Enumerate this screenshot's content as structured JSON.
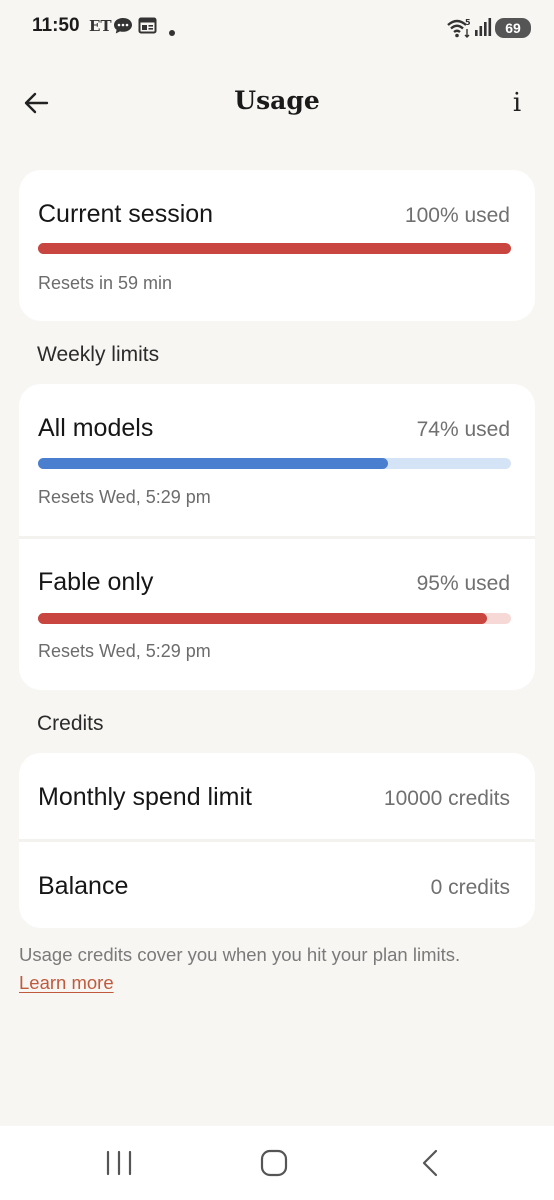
{
  "status_bar": {
    "time": "11:50",
    "carrier_label": "ET",
    "battery": "69",
    "icons": [
      "chat-bubble-icon",
      "calendar-icon",
      "dot-icon",
      "wifi-icon",
      "signal-icon"
    ]
  },
  "header": {
    "title": "Usage",
    "info_label": "i"
  },
  "current_session": {
    "title": "Current session",
    "used_label": "100% used",
    "used_fraction": 1.0,
    "reset_text": "Resets in 59 min"
  },
  "weekly": {
    "section_label": "Weekly limits",
    "items": [
      {
        "title": "All models",
        "used_label": "74% used",
        "used_fraction": 0.74,
        "reset_text": "Resets Wed, 5:29 pm",
        "fill_color": "#4a7fd0",
        "track_color": "#d5e3f7"
      },
      {
        "title": "Fable only",
        "used_label": "95% used",
        "used_fraction": 0.95,
        "reset_text": "Resets Wed, 5:29 pm",
        "fill_color": "#c8463f",
        "track_color": "#f6d9d6"
      }
    ]
  },
  "credits": {
    "section_label": "Credits",
    "monthly_label": "Monthly spend limit",
    "monthly_value": "10000 credits",
    "balance_label": "Balance",
    "balance_value": "0 credits"
  },
  "footnote": {
    "text": "Usage credits cover you when you hit your plan limits.",
    "link": "Learn more"
  },
  "colors": {
    "red": "#c8463f",
    "blue": "#4a7fd0",
    "link": "#c05a3d",
    "background": "#f7f6f3"
  }
}
